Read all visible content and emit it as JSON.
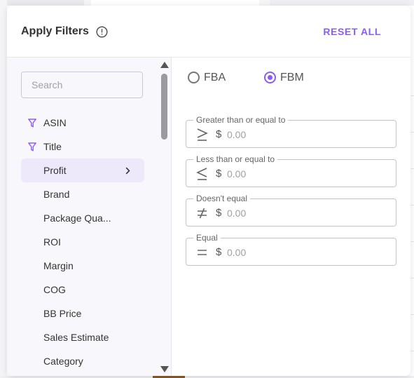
{
  "header": {
    "title": "Apply Filters",
    "reset_label": "RESET ALL"
  },
  "search": {
    "placeholder": "Search",
    "value": ""
  },
  "filters": [
    {
      "label": "ASIN",
      "icon": "funnel-icon",
      "active": false
    },
    {
      "label": "Title",
      "icon": "funnel-icon",
      "active": false
    },
    {
      "label": "Profit",
      "icon": "chevron-right-icon",
      "active": true
    },
    {
      "label": "Brand"
    },
    {
      "label": "Package Qua..."
    },
    {
      "label": "ROI"
    },
    {
      "label": "Margin"
    },
    {
      "label": "COG"
    },
    {
      "label": "BB Price"
    },
    {
      "label": "Sales Estimate"
    },
    {
      "label": "Category"
    }
  ],
  "fulfillment": {
    "options": [
      {
        "label": "FBA",
        "checked": false
      },
      {
        "label": "FBM",
        "checked": true
      }
    ]
  },
  "conditions": [
    {
      "label": "Greater than or equal to",
      "operator_icon": "greater-than-or-equal-icon",
      "currency": "$",
      "placeholder": "0.00"
    },
    {
      "label": "Less than or equal to",
      "operator_icon": "less-than-or-equal-icon",
      "currency": "$",
      "placeholder": "0.00"
    },
    {
      "label": "Doesn't equal",
      "operator_icon": "not-equal-icon",
      "currency": "$",
      "placeholder": "0.00"
    },
    {
      "label": "Equal",
      "operator_icon": "equal-icon",
      "currency": "$",
      "placeholder": "0.00"
    }
  ],
  "colors": {
    "accent": "#8b5cf6",
    "active_bg": "#ede9fb"
  }
}
